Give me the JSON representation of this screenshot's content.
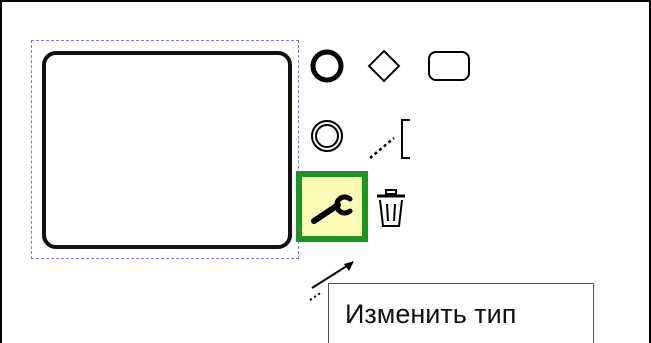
{
  "context_pad": {
    "tooltip_text": "Изменить тип",
    "entries": [
      {
        "name": "end-event",
        "icon": "end-event-icon"
      },
      {
        "name": "gateway",
        "icon": "gateway-diamond-icon"
      },
      {
        "name": "task",
        "icon": "task-rounded-rect-icon"
      },
      {
        "name": "intermediate-event",
        "icon": "intermediate-event-icon"
      },
      {
        "name": "text-annotation",
        "icon": "text-annotation-icon"
      },
      {
        "name": "change-type",
        "icon": "wrench-icon",
        "highlighted": true
      },
      {
        "name": "delete",
        "icon": "trash-icon"
      },
      {
        "name": "connect",
        "icon": "connection-arrow-icon"
      }
    ]
  },
  "colors": {
    "selection_outline": "#7b7bf0",
    "hover_border": "#1f9420",
    "hover_fill": "#fbfbb5"
  }
}
